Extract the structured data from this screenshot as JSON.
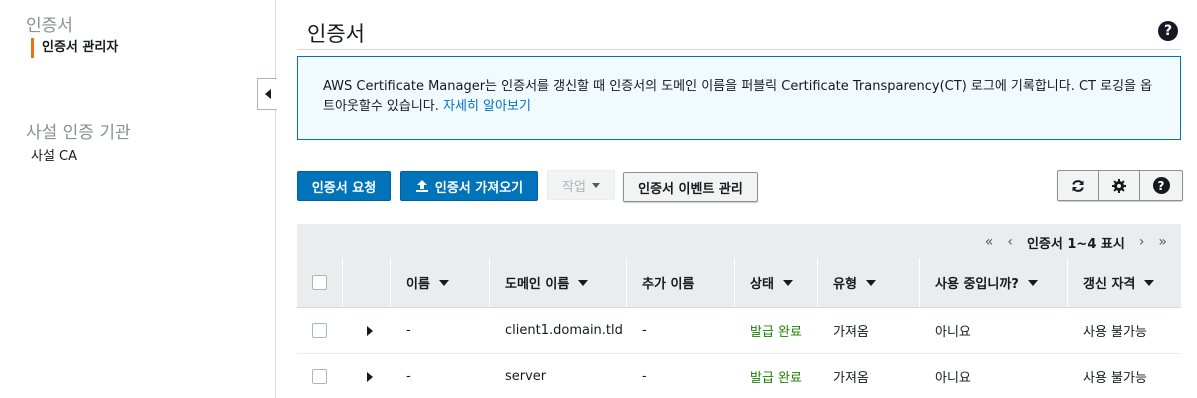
{
  "sidebar": {
    "section1_title": "인증서",
    "section1_item": "인증서 관리자",
    "section2_title": "사설 인증 기관",
    "section2_item": "사설 CA"
  },
  "page": {
    "title": "인증서"
  },
  "info": {
    "text": "AWS Certificate Manager는 인증서를 갱신할 때 인증서의 도메인 이름을 퍼블릭 Certificate Transparency(CT) 로그에 기록합니다. CT 로깅을 옵트아웃할수 있습니다. ",
    "link": "자세히 알아보기"
  },
  "toolbar": {
    "request_label": "인증서 요청",
    "import_label": "인증서 가져오기",
    "actions_label": "작업",
    "events_label": "인증서 이벤트 관리"
  },
  "pager": {
    "text": "인증서 1~4 표시"
  },
  "table": {
    "headers": [
      "이름",
      "도메인 이름",
      "추가 이름",
      "상태",
      "유형",
      "사용 중입니까?",
      "갱신 자격"
    ],
    "rows": [
      {
        "name": "-",
        "domain": "client1.domain.tld",
        "additional": "-",
        "status": "발급 완료",
        "type": "가져옴",
        "in_use": "아니요",
        "renewal": "사용 불가능"
      },
      {
        "name": "-",
        "domain": "server",
        "additional": "-",
        "status": "발급 완료",
        "type": "가져옴",
        "in_use": "아니요",
        "renewal": "사용 불가능"
      }
    ]
  },
  "colors": {
    "primary": "#0073bb",
    "success": "#1d8102",
    "accent": "#ec7211"
  },
  "icons": [
    "chevron-left-icon",
    "help-icon",
    "upload-icon",
    "caret-down-icon",
    "refresh-icon",
    "gear-icon",
    "first-page-icon",
    "prev-page-icon",
    "next-page-icon",
    "last-page-icon",
    "expand-icon",
    "sort-icon"
  ]
}
